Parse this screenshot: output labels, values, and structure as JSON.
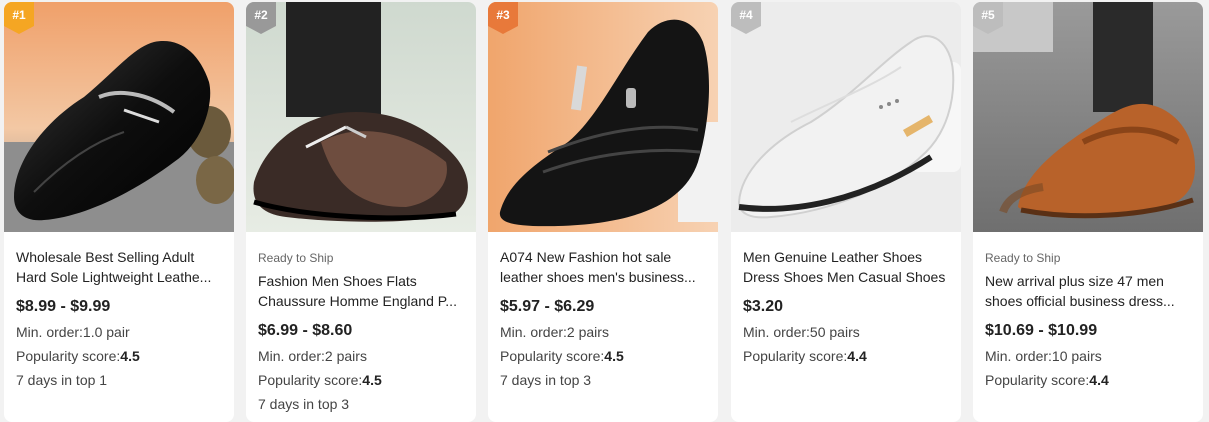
{
  "products": [
    {
      "rank": "#1",
      "ready": "",
      "title_line1": "Wholesale Best Selling Adult",
      "title_line2": "Hard Sole Lightweight Leathe...",
      "price": "$8.99 - $9.99",
      "min_order_label": "Min. order:",
      "min_order_value": "1.0 pair",
      "popularity_label": "Popularity score:",
      "popularity_value": "4.5",
      "top": "7 days in top 1",
      "badge_color": "#f5a623"
    },
    {
      "rank": "#2",
      "ready": "Ready to Ship",
      "title_line1": "Fashion Men Shoes Flats",
      "title_line2": "Chaussure Homme England P...",
      "price": "$6.99 - $8.60",
      "min_order_label": "Min. order:",
      "min_order_value": "2 pairs",
      "popularity_label": "Popularity score:",
      "popularity_value": "4.5",
      "top": "7 days in top 3",
      "badge_color": "#999999"
    },
    {
      "rank": "#3",
      "ready": "",
      "title_line1": "A074 New Fashion hot sale",
      "title_line2": "leather shoes men's business...",
      "price": "$5.97 - $6.29",
      "min_order_label": "Min. order:",
      "min_order_value": "2 pairs",
      "popularity_label": "Popularity score:",
      "popularity_value": "4.5",
      "top": "7 days in top 3",
      "badge_color": "#e8793a"
    },
    {
      "rank": "#4",
      "ready": "",
      "title_line1": "Men Genuine Leather Shoes",
      "title_line2": "Dress Shoes Men Casual Shoes",
      "price": "$3.20",
      "min_order_label": "Min. order:",
      "min_order_value": "50 pairs",
      "popularity_label": "Popularity score:",
      "popularity_value": "4.4",
      "top": "",
      "badge_color": "#bdbdbd"
    },
    {
      "rank": "#5",
      "ready": "Ready to Ship",
      "title_line1": "New arrival plus size 47 men",
      "title_line2": "shoes official business dress...",
      "price": "$10.69 - $10.99",
      "min_order_label": "Min. order:",
      "min_order_value": "10 pairs",
      "popularity_label": "Popularity score:",
      "popularity_value": "4.4",
      "top": "",
      "badge_color": "#bdbdbd"
    }
  ]
}
